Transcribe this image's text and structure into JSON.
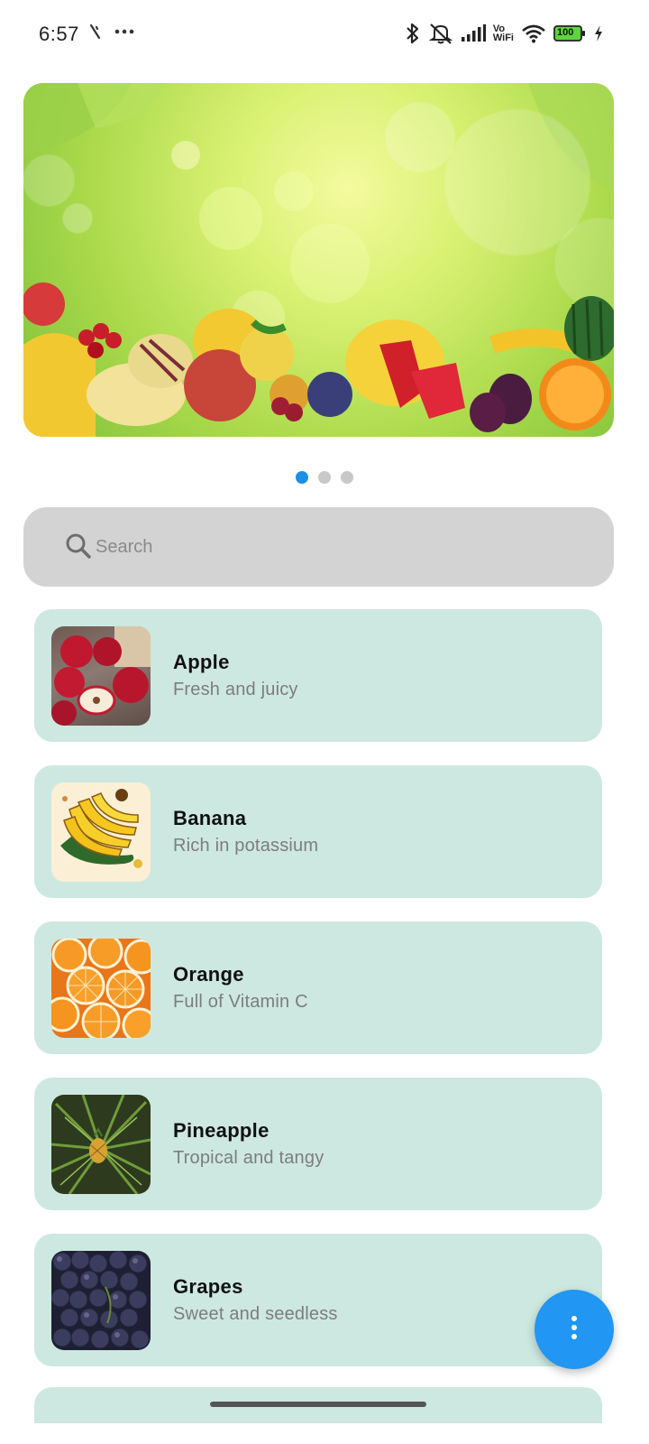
{
  "status_bar": {
    "time": "6:57",
    "battery": "100",
    "icons": [
      "signal-strength-icon",
      "more-dots-icon",
      "bluetooth-icon",
      "silent-bell-icon",
      "cellular-signal-icon",
      "vowifi-icon",
      "wifi-icon",
      "battery-icon",
      "charging-bolt-icon"
    ],
    "vowifi_top": "Vo",
    "vowifi_bottom": "WiFi"
  },
  "banner": {
    "description_icon": "fruit-banner-image",
    "pages": 3,
    "active_page": 1
  },
  "search": {
    "placeholder": "Search",
    "value": ""
  },
  "fruits": [
    {
      "name": "Apple",
      "description": "Fresh and juicy",
      "thumb_icon": "apple-thumbnail"
    },
    {
      "name": "Banana",
      "description": "Rich in potassium",
      "thumb_icon": "banana-thumbnail"
    },
    {
      "name": "Orange",
      "description": "Full of Vitamin C",
      "thumb_icon": "orange-thumbnail"
    },
    {
      "name": "Pineapple",
      "description": "Tropical and tangy",
      "thumb_icon": "pineapple-thumbnail"
    },
    {
      "name": "Grapes",
      "description": "Sweet and seedless",
      "thumb_icon": "grapes-thumbnail"
    }
  ],
  "fab": {
    "icon": "more-vertical-icon"
  },
  "colors": {
    "card_bg": "#cde8e0",
    "search_bg": "#d3d3d3",
    "accent": "#2196f3",
    "active_dot": "#1e8ee6",
    "inactive_dot": "#c8c8c8"
  }
}
